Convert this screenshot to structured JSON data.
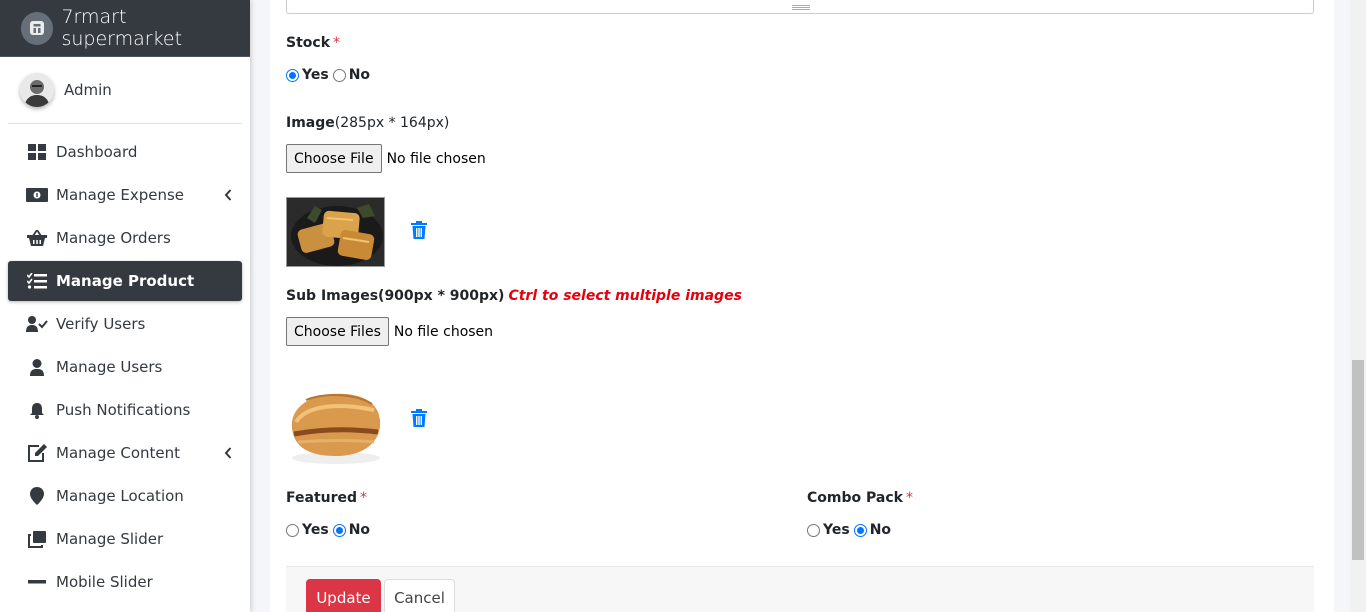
{
  "app": {
    "brand": "7rmart supermarket"
  },
  "user": {
    "name": "Admin"
  },
  "sidebar": {
    "items": [
      {
        "label": "Dashboard"
      },
      {
        "label": "Manage Expense"
      },
      {
        "label": "Manage Orders"
      },
      {
        "label": "Manage Product"
      },
      {
        "label": "Verify Users"
      },
      {
        "label": "Manage Users"
      },
      {
        "label": "Push Notifications"
      },
      {
        "label": "Manage Content"
      },
      {
        "label": "Manage Location"
      },
      {
        "label": "Manage Slider"
      },
      {
        "label": "Mobile Slider"
      }
    ]
  },
  "form": {
    "stock": {
      "label": "Stock",
      "required": "*",
      "yes": "Yes",
      "no": "No",
      "selected": "Yes"
    },
    "image": {
      "label": "Image",
      "hint": "(285px * 164px)",
      "button": "Choose File",
      "status": "No file chosen"
    },
    "sub_images": {
      "label": "Sub Images(900px * 900px)",
      "note": "Ctrl to select multiple images",
      "button": "Choose Files",
      "status": "No file chosen"
    },
    "featured": {
      "label": "Featured",
      "required": "*",
      "yes": "Yes",
      "no": "No",
      "selected": "No"
    },
    "combo_pack": {
      "label": "Combo Pack",
      "required": "*",
      "yes": "Yes",
      "no": "No",
      "selected": "No"
    }
  },
  "actions": {
    "update": "Update",
    "cancel": "Cancel"
  },
  "colors": {
    "sidebar_dark": "#343a40",
    "danger": "#dc3545",
    "link_blue": "#007bff",
    "note_red": "#e3000f"
  }
}
